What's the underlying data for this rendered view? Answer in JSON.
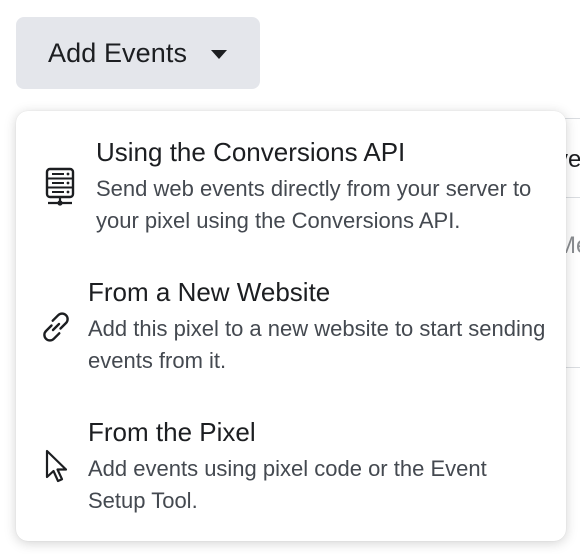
{
  "add_events_button": {
    "label": "Add Events",
    "icon": "caret-down-icon"
  },
  "background": {
    "fragment_top": "ve",
    "fragment_mid": "Me"
  },
  "menu": {
    "items": [
      {
        "title": "Using the Conversions API",
        "description": "Send web events directly from your server to your pixel using the Conversions API.",
        "icon": "server-icon"
      },
      {
        "title": "From a New Website",
        "description": "Add this pixel to a new website to start sending events from it.",
        "icon": "link-icon"
      },
      {
        "title": "From the Pixel",
        "description": "Add events using pixel code or the Event Setup Tool.",
        "icon": "cursor-icon"
      }
    ]
  }
}
